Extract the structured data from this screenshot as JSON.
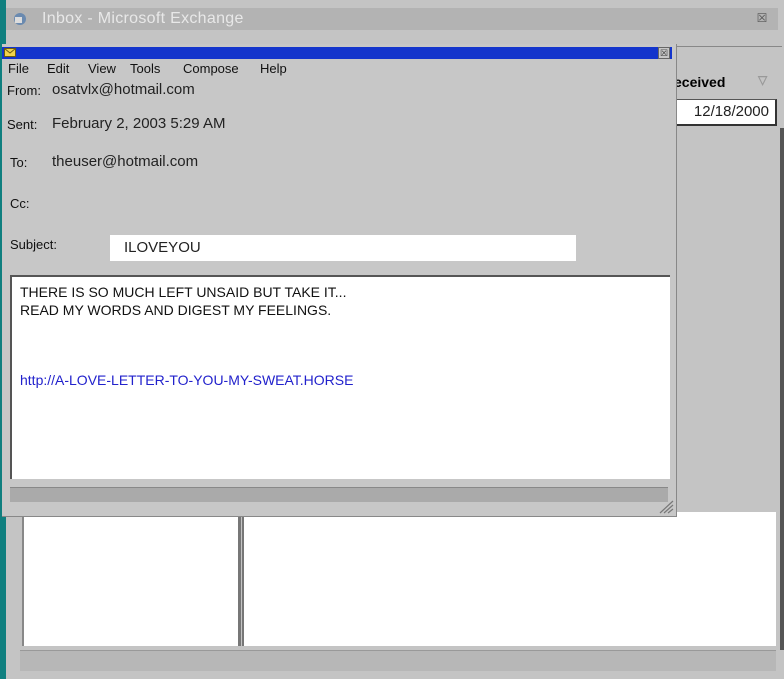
{
  "inbox": {
    "title": "Inbox - Microsoft Exchange",
    "close_glyph": "☒",
    "column_received": "eceived",
    "sort_glyph": "▽",
    "received_value": "12/18/2000"
  },
  "message": {
    "close_glyph": "☒",
    "menu": [
      "File",
      "Edit",
      "View",
      "Tools",
      "Compose",
      "Help"
    ],
    "from_label": "From:",
    "from_value": "osatvlx@hotmail.com",
    "sent_label": "Sent:",
    "sent_value": "February 2, 2003 5:29 AM",
    "to_label": "To:",
    "to_value": "theuser@hotmail.com",
    "cc_label": "Cc:",
    "subject_label": "Subject:",
    "subject_value": "ILOVEYOU",
    "body_lines": [
      "THERE IS SO MUCH LEFT UNSAID BUT TAKE IT...",
      "READ MY WORDS AND DIGEST MY FEELINGS."
    ],
    "body_link": "http://A-LOVE-LETTER-TO-YOU-MY-SWEAT.HORSE"
  },
  "colors": {
    "desktop": "#0f7f7f",
    "active_titlebar": "#1435cc",
    "link": "#2222cc"
  }
}
